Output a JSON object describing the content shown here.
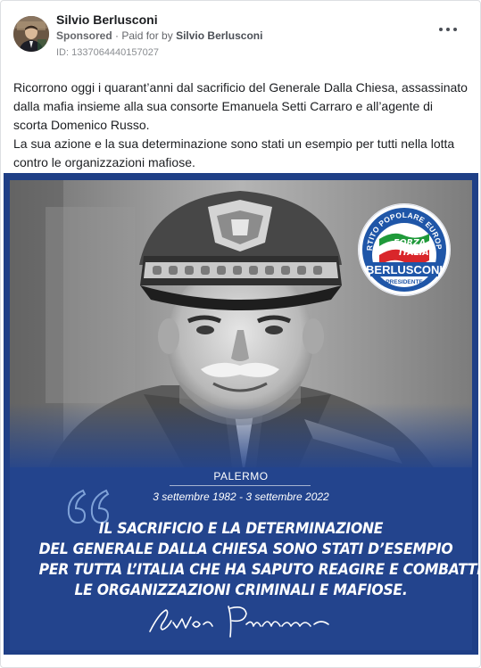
{
  "post": {
    "page_name": "Silvio Berlusconi",
    "sponsored_label": "Sponsored",
    "separator": "·",
    "paid_for_prefix": "Paid for by",
    "paid_for_name": "Silvio Berlusconi",
    "ad_id": "ID: 1337064440157027",
    "more_icon": "more-dots-icon"
  },
  "body": {
    "paragraph_1": "Ricorrono oggi i quarant’anni dal sacrificio del Generale Dalla Chiesa, assassinato dalla mafia insieme alla sua consorte Emanuela Setti Carraro e all’agente di scorta Domenico Russo.",
    "paragraph_2": "La sua azione e la sua determinazione sono stati un esempio per tutti nella lotta contro le organizzazioni mafiose."
  },
  "creative": {
    "place": "PALERMO",
    "dates": "3 settembre 1982 - 3 settembre 2022",
    "quote": [
      "IL SACRIFICIO E LA DETERMINAZIONE",
      "DEL GENERALE DALLA CHIESA SONO STATI D’ESEMPIO",
      "PER TUTTA L’ITALIA CHE HA SAPUTO REAGIRE E COMBATTERE",
      "LE ORGANIZZAZIONI CRIMINALI E MAFIOSE."
    ],
    "signature_text": "Silvio Berlusconi",
    "logo": {
      "arc_text": "PARTITO POPOLARE EUROPEO",
      "flag_line_1": "FORZA",
      "flag_line_2": "ITALIA",
      "name": "BERLUSCONI",
      "role": "PRESIDENTE"
    }
  },
  "colors": {
    "brand_blue": "#23448d",
    "logo_blue": "#1f56a8",
    "italy_green": "#1f9a3a",
    "italy_red": "#d9262b",
    "text_primary": "#1c1e21",
    "text_secondary": "#65676b"
  }
}
